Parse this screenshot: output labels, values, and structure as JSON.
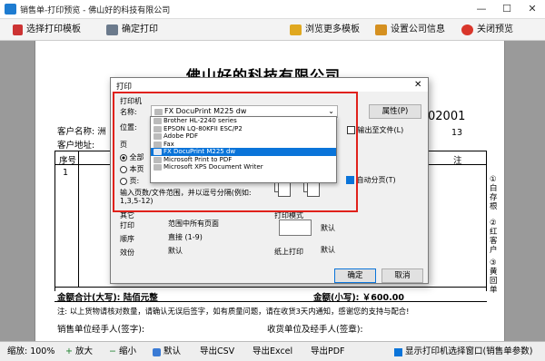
{
  "window": {
    "title": "销售单-打印预览 - 佛山好的科技有限公司",
    "min": "—",
    "max": "☐",
    "close": "✕"
  },
  "toolbar": {
    "select_template": "选择打印模板",
    "confirm_print": "确定打印",
    "browse_templates": "浏览更多模板",
    "company_info": "设置公司信息",
    "close_preview": "关闭预览"
  },
  "doc": {
    "company": "佛山好的科技有限公司",
    "customer_name": "客户名称: 洲",
    "customer_address": "客户地址:",
    "doc_no_partial": "02001",
    "date_partial": "13",
    "col_seq": "序号",
    "col_remark": "注",
    "row1_seq": "1",
    "total_upper": "金额合计(大写): 陆佰元整",
    "total_lower": "金额(小写): ￥600.00",
    "note": "注: 以上货物请核对数量，请确认无误后签字，如有质量问题，请在收货3天内通知，感谢您的支持与配合!",
    "seller_sign": "销售单位经手人(签字):",
    "receiver_sign": "收货单位及经手人(签章):",
    "side_labels": [
      "①白存根",
      "②红客户",
      "③黄回单"
    ]
  },
  "dialog": {
    "title": "打印",
    "close": "✕",
    "printer_group": "打印机",
    "name_label": "名称:",
    "printer_selected": "FX DocuPrint M225 dw",
    "properties": "属性(P)",
    "location_label": "位置:",
    "print_to_file": "输出至文件(L)",
    "page_group": "页",
    "all_pages": "全部",
    "current_page": "本页",
    "pages_opt": "页:",
    "pages_hint": "输入页数/文件范围，并以逗号分隔(例如: 1,3,5-12)",
    "auto_paging": "自动分页(T)",
    "other_group": "其它",
    "print_label": "打印",
    "print_value": "范围中所有页面",
    "order_label": "顺序",
    "order_value": "直接 (1-9)",
    "copies_label": "效份",
    "copies_value": "默认",
    "zoom_group": "打印模式",
    "zoom_value": "默认",
    "paper_label": "纸上打印",
    "paper_value": "默认",
    "ok": "确定",
    "cancel": "取消",
    "printers": [
      "Brother HL-2240 series",
      "EPSON LQ-80KFII ESC/P2",
      "Adobe PDF",
      "Fax",
      "FX DocuPrint M225 dw",
      "Microsoft Print to PDF",
      "Microsoft XPS Document Writer"
    ]
  },
  "status": {
    "zoom": "缩放: 100%",
    "zoom_in": "放大",
    "zoom_out": "缩小",
    "default": "默认",
    "export_csv": "导出CSV",
    "export_excel": "导出Excel",
    "export_pdf": "导出PDF",
    "show_dialog": "显示打印机选择窗口(销售单参数)"
  }
}
